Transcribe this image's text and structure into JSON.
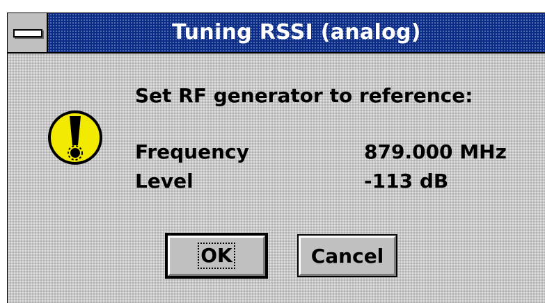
{
  "window": {
    "title": "Tuning RSSI (analog)",
    "system_menu_icon": "system-menu-icon"
  },
  "message": {
    "icon": "exclamation-icon",
    "icon_color": "#f2ea00",
    "instruction": "Set RF generator to reference:",
    "rows": [
      {
        "label": "Frequency",
        "value": "879.000 MHz"
      },
      {
        "label": "Level",
        "value": "-113 dB"
      }
    ]
  },
  "buttons": {
    "ok_label": "OK",
    "cancel_label": "Cancel"
  },
  "colors": {
    "titlebar": "#0a2c86",
    "dialog_bg": "#c6c6c6",
    "button_face": "#c0c0c0"
  }
}
